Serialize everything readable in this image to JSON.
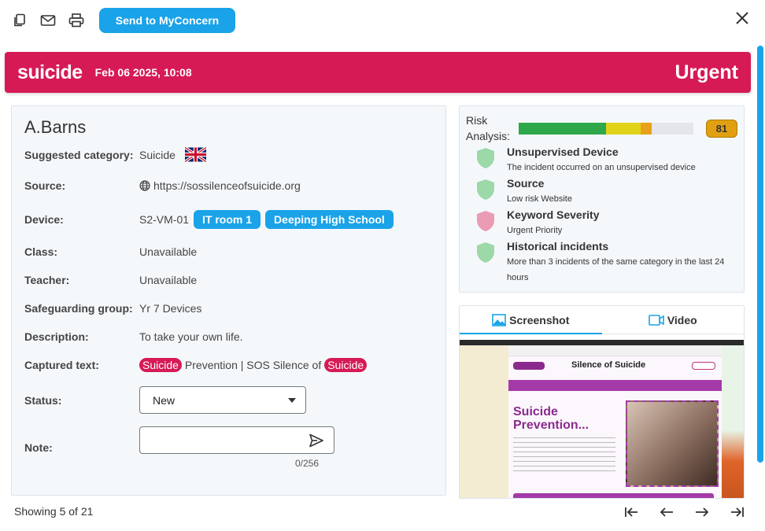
{
  "toolbar": {
    "send_label": "Send to MyConcern",
    "icons": [
      "copy-icon",
      "mail-icon",
      "print-icon"
    ]
  },
  "banner": {
    "category": "suicide",
    "datetime": "Feb 06 2025, 10:08",
    "priority": "Urgent",
    "color": "#d61a55"
  },
  "details": {
    "name": "A.Barns",
    "suggested_category": {
      "label": "Suggested category:",
      "value": "Suicide"
    },
    "source": {
      "label": "Source:",
      "value": "https://sossilenceofsuicide.org"
    },
    "device": {
      "label": "Device:",
      "value": "S2-VM-01",
      "tags": [
        "IT room 1",
        "Deeping High School"
      ]
    },
    "class": {
      "label": "Class:",
      "value": "Unavailable"
    },
    "teacher": {
      "label": "Teacher:",
      "value": "Unavailable"
    },
    "safeguarding": {
      "label": "Safeguarding group:",
      "value": "Yr 7 Devices"
    },
    "description": {
      "label": "Description:",
      "value": "To take your own life."
    },
    "captured": {
      "label": "Captured text:",
      "kw1": "Suicide",
      "middle": "Prevention | SOS Silence of",
      "kw2": "Suicide"
    },
    "status": {
      "label": "Status:",
      "value": "New"
    },
    "note": {
      "label": "Note:",
      "value": "",
      "counter": "0/256"
    }
  },
  "risk": {
    "title": "Risk Analysis:",
    "score": "81",
    "segments": [
      {
        "color": "#2ea84a",
        "fraction": 0.5
      },
      {
        "color": "#e0d31a",
        "fraction": 0.2
      },
      {
        "color": "#e8a11a",
        "fraction": 0.06
      }
    ],
    "factors": [
      {
        "title": "Unsupervised Device",
        "desc": "The incident occurred on an unsupervised device",
        "level": "low"
      },
      {
        "title": "Source",
        "desc": "Low risk Website",
        "level": "low"
      },
      {
        "title": "Keyword Severity",
        "desc": "Urgent Priority",
        "level": "high"
      },
      {
        "title": "Historical incidents",
        "desc": "More than 3 incidents of the same category in the last 24 hours",
        "level": "low"
      }
    ]
  },
  "media": {
    "tabs": [
      "Screenshot",
      "Video"
    ],
    "active": "Screenshot",
    "shot": {
      "site_title": "Silence of Suicide",
      "headline1": "Suicide",
      "headline2": "Prevention..."
    }
  },
  "footer": {
    "showing": "Showing 5 of 21"
  }
}
